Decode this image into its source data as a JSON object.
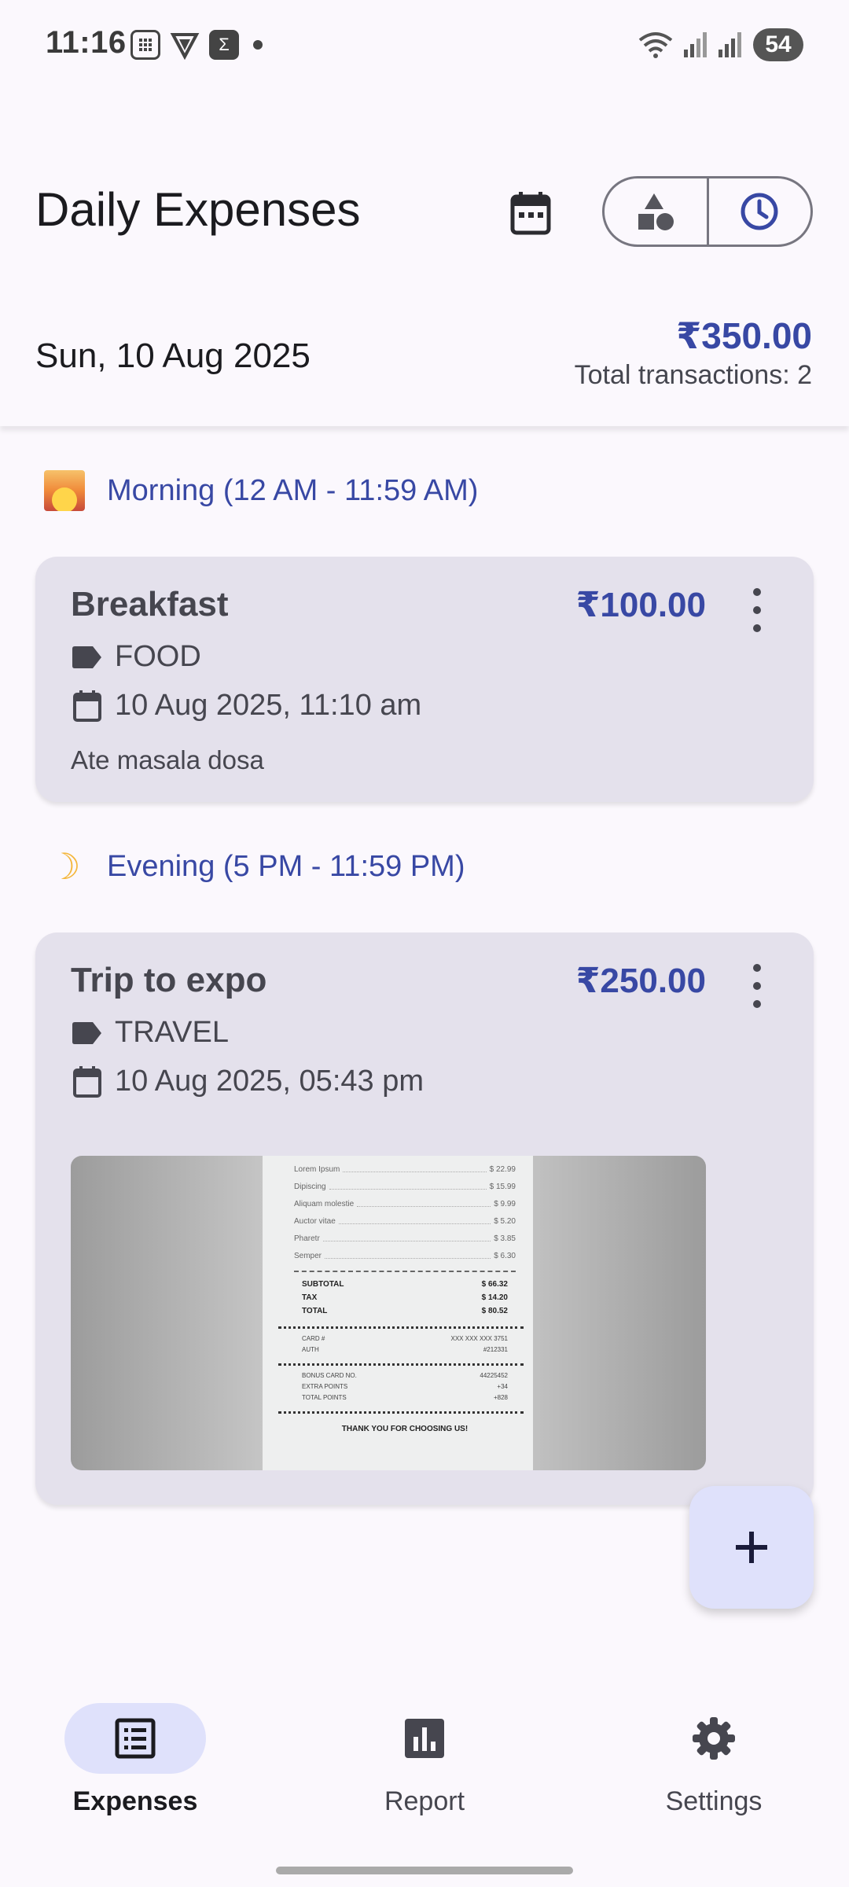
{
  "status_bar": {
    "time": "11:16",
    "battery": "54",
    "icons": [
      "calculator-icon",
      "shield-icon",
      "sigma-icon",
      "dot-icon",
      "wifi-icon",
      "signal-icon",
      "signal-icon-2"
    ]
  },
  "header": {
    "title": "Daily Expenses",
    "calendar_icon": "calendar-icon",
    "segment": [
      "category-icon",
      "clock-icon"
    ]
  },
  "summary": {
    "date": "Sun, 10 Aug 2025",
    "total": "₹350.00",
    "count": "Total transactions: 2"
  },
  "sections": [
    {
      "label": "Morning (12 AM - 11:59 AM)",
      "icon": "sunrise-icon",
      "items": [
        {
          "title": "Breakfast",
          "amount": "₹100.00",
          "category": "FOOD",
          "datetime": "10 Aug 2025, 11:10 am",
          "note": "Ate masala dosa"
        }
      ]
    },
    {
      "label": "Evening (5 PM - 11:59 PM)",
      "icon": "moon-icon",
      "items": [
        {
          "title": "Trip to expo",
          "amount": "₹250.00",
          "category": "TRAVEL",
          "datetime": "10 Aug 2025, 05:43 pm",
          "receipt": {
            "lines": [
              {
                "name": "Lorem Ipsum",
                "price": "$ 22.99"
              },
              {
                "name": "Dipiscing",
                "price": "$ 15.99"
              },
              {
                "name": "Aliquam molestie",
                "price": "$ 9.99"
              },
              {
                "name": "Auctor vitae",
                "price": "$ 5.20"
              },
              {
                "name": "Pharetr",
                "price": "$ 3.85"
              },
              {
                "name": "Semper",
                "price": "$ 6.30"
              }
            ],
            "subtotal_label": "SUBTOTAL",
            "subtotal": "$ 66.32",
            "tax_label": "TAX",
            "tax": "$ 14.20",
            "total_label": "TOTAL",
            "total": "$ 80.52",
            "card_label": "CARD #",
            "card": "XXX XXX XXX 3751",
            "auth_label": "AUTH",
            "auth": "#212331",
            "bonus_label": "BONUS CARD NO.",
            "bonus": "44225452",
            "extra_label": "EXTRA POINTS",
            "extra": "+34",
            "points_label": "TOTAL POINTS",
            "points": "+828",
            "thanks": "THANK YOU FOR CHOOSING US!"
          }
        }
      ]
    }
  ],
  "fab": {
    "icon": "plus-icon"
  },
  "nav": [
    {
      "label": "Expenses",
      "icon": "list-icon",
      "active": true
    },
    {
      "label": "Report",
      "icon": "bar-chart-icon",
      "active": false
    },
    {
      "label": "Settings",
      "icon": "gear-icon",
      "active": false
    }
  ],
  "colors": {
    "accent": "#3848a4",
    "card": "#e4e1ec",
    "fab": "#dfe1fb"
  }
}
